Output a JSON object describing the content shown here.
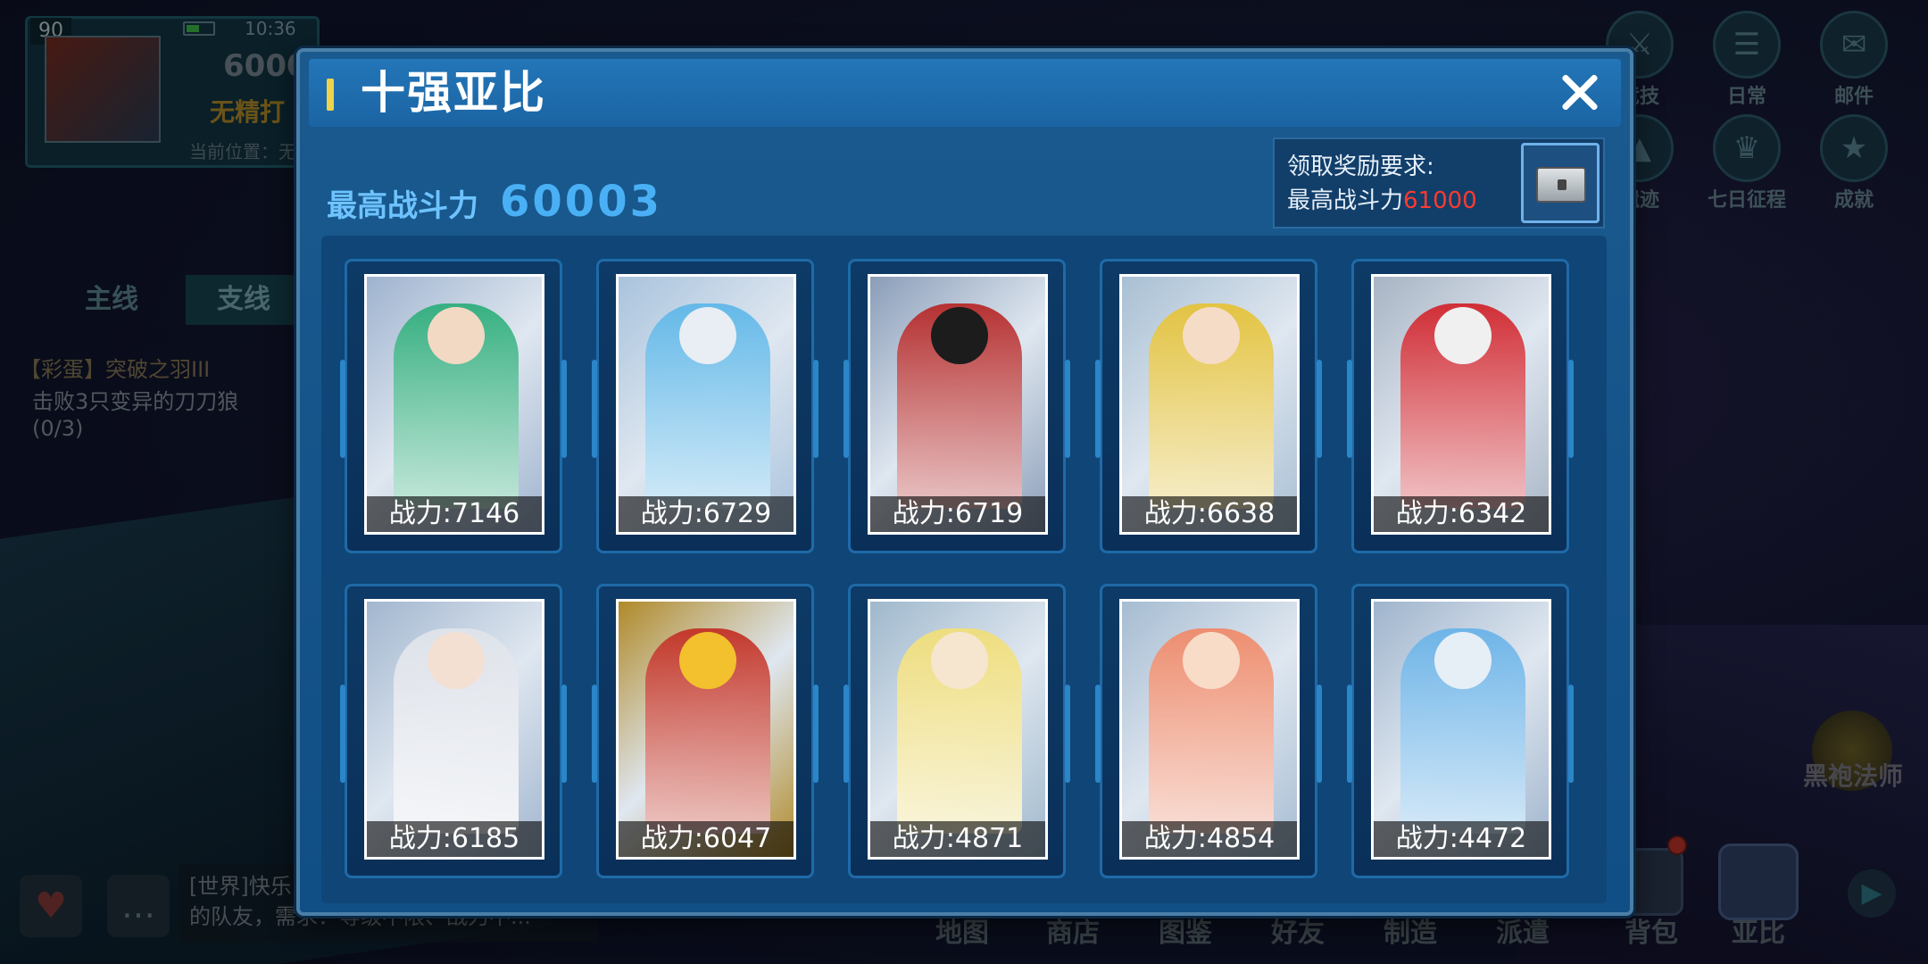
{
  "background": {
    "player": {
      "level": "90",
      "time": "10:36",
      "power": "6000",
      "badge": "无精打",
      "location": "当前位置：无尽海"
    },
    "quest": {
      "tab_main": "主线",
      "tab_side": "支线",
      "title": "【彩蛋】突破之羽III",
      "desc": "击败3只变异的刀刀狼",
      "progress": "(0/3)"
    },
    "top_icons": [
      {
        "label": "竞技",
        "icon": "arena-icon"
      },
      {
        "label": "日常",
        "icon": "daily-icon"
      },
      {
        "label": "邮件",
        "icon": "mail-icon"
      },
      {
        "label": "遗迹",
        "icon": "ruins-icon"
      },
      {
        "label": "七日征程",
        "icon": "seven-day-icon"
      },
      {
        "label": "成就",
        "icon": "achievement-icon"
      }
    ],
    "chat": {
      "line1": "[世界]快乐...",
      "line2": "的队友，需求：等级不限、战力不..."
    },
    "bottom_menu": [
      "地图",
      "商店",
      "图鉴",
      "好友",
      "制造",
      "派遣",
      "背包",
      "亚比"
    ],
    "npc_label": "黑袍法师"
  },
  "modal": {
    "title": "十强亚比",
    "max_power_label": "最高战斗力",
    "max_power_value": "60003",
    "reward_line1": "领取奖励要求:",
    "reward_line2_prefix": "最高战斗力",
    "reward_line2_value": "61000",
    "cards": [
      {
        "power": "战力:7146",
        "bg": "#9fb3cf",
        "figure": "#2fae7c",
        "head": "#f2d9c4"
      },
      {
        "power": "战力:6729",
        "bg": "#a9c3dd",
        "figure": "#5fb7e8",
        "head": "#e8eef4"
      },
      {
        "power": "战力:6719",
        "bg": "#8a9db8",
        "figure": "#b52a2a",
        "head": "#1c1c1c"
      },
      {
        "power": "战力:6638",
        "bg": "#a8bfd3",
        "figure": "#e4c23a",
        "head": "#f5dcc6"
      },
      {
        "power": "战力:6342",
        "bg": "#a8b4c4",
        "figure": "#d1262e",
        "head": "#f0f0f0"
      },
      {
        "power": "战力:6185",
        "bg": "#a2b6cf",
        "figure": "#dfe3ea",
        "head": "#f4e0d2"
      },
      {
        "power": "战力:6047",
        "bg": "#b08a2a",
        "figure": "#c23226",
        "head": "#f2c12d"
      },
      {
        "power": "战力:4871",
        "bg": "#9fb8cc",
        "figure": "#f0de7a",
        "head": "#f6e6d0"
      },
      {
        "power": "战力:4854",
        "bg": "#a6bcd2",
        "figure": "#ef8a6a",
        "head": "#f8dcc8"
      },
      {
        "power": "战力:4472",
        "bg": "#9fb4cc",
        "figure": "#6ab3e8",
        "head": "#e6eef6"
      }
    ]
  }
}
